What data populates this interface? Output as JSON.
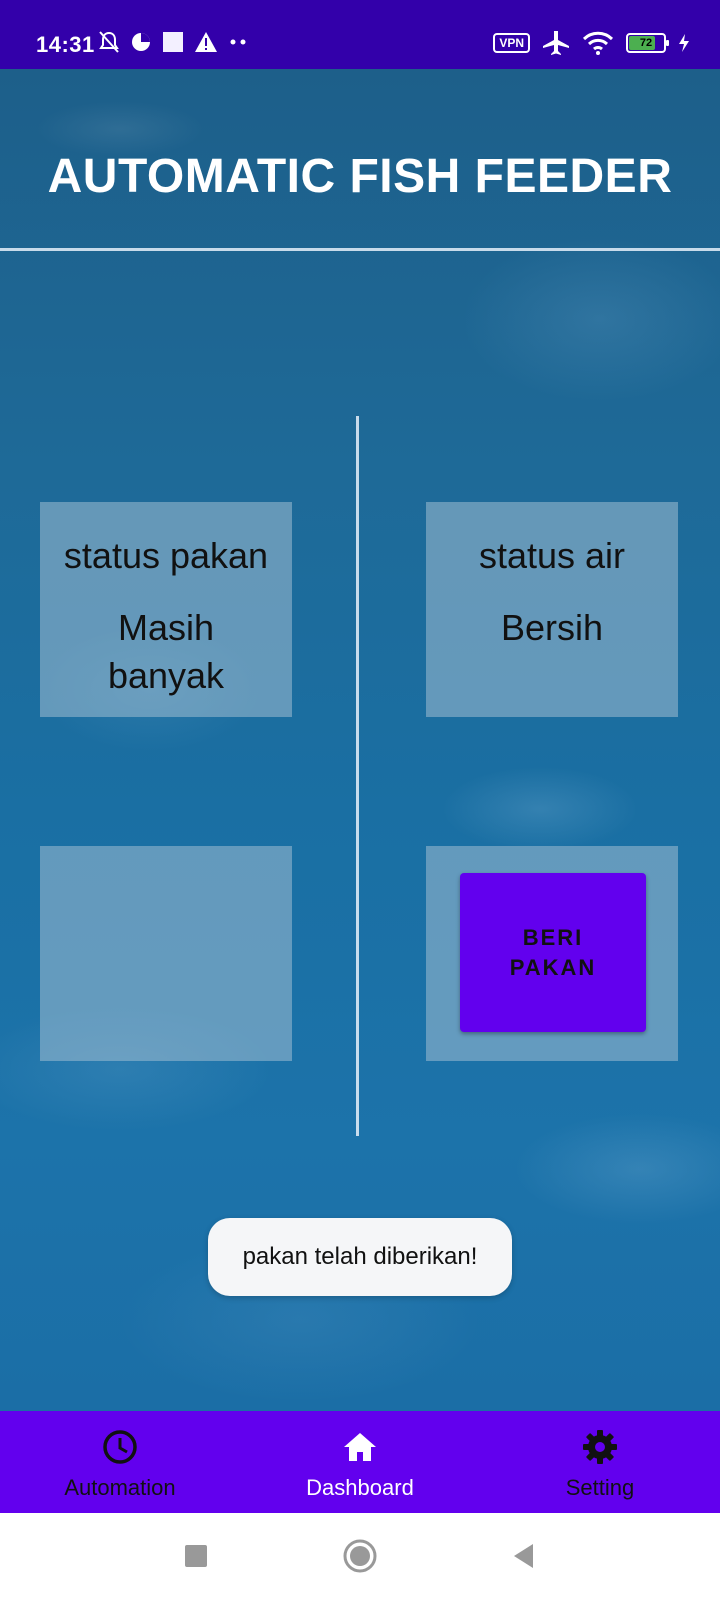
{
  "status_bar": {
    "time": "14:31",
    "vpn_label": "VPN",
    "battery_level": "72",
    "colors": {
      "background": "#3300aa"
    }
  },
  "header": {
    "title": "AUTOMATIC FISH FEEDER"
  },
  "panels": {
    "pakan": {
      "label": "status pakan",
      "value_line1": "Masih",
      "value_line2": "banyak"
    },
    "air": {
      "label": "status air",
      "value": "Bersih"
    }
  },
  "feed_button": {
    "label_line1": "BERI",
    "label_line2": "PAKAN",
    "color": "#6200ee"
  },
  "toast": {
    "message": "pakan telah diberikan!"
  },
  "bottom_nav": {
    "items": [
      {
        "label": "Automation",
        "icon": "clock-icon",
        "active": false
      },
      {
        "label": "Dashboard",
        "icon": "home-icon",
        "active": true
      },
      {
        "label": "Setting",
        "icon": "gear-icon",
        "active": false
      }
    ],
    "color": "#6200ee"
  },
  "system_nav": {
    "icons": [
      "recents-square-icon",
      "home-circle-icon",
      "back-triangle-icon"
    ]
  }
}
